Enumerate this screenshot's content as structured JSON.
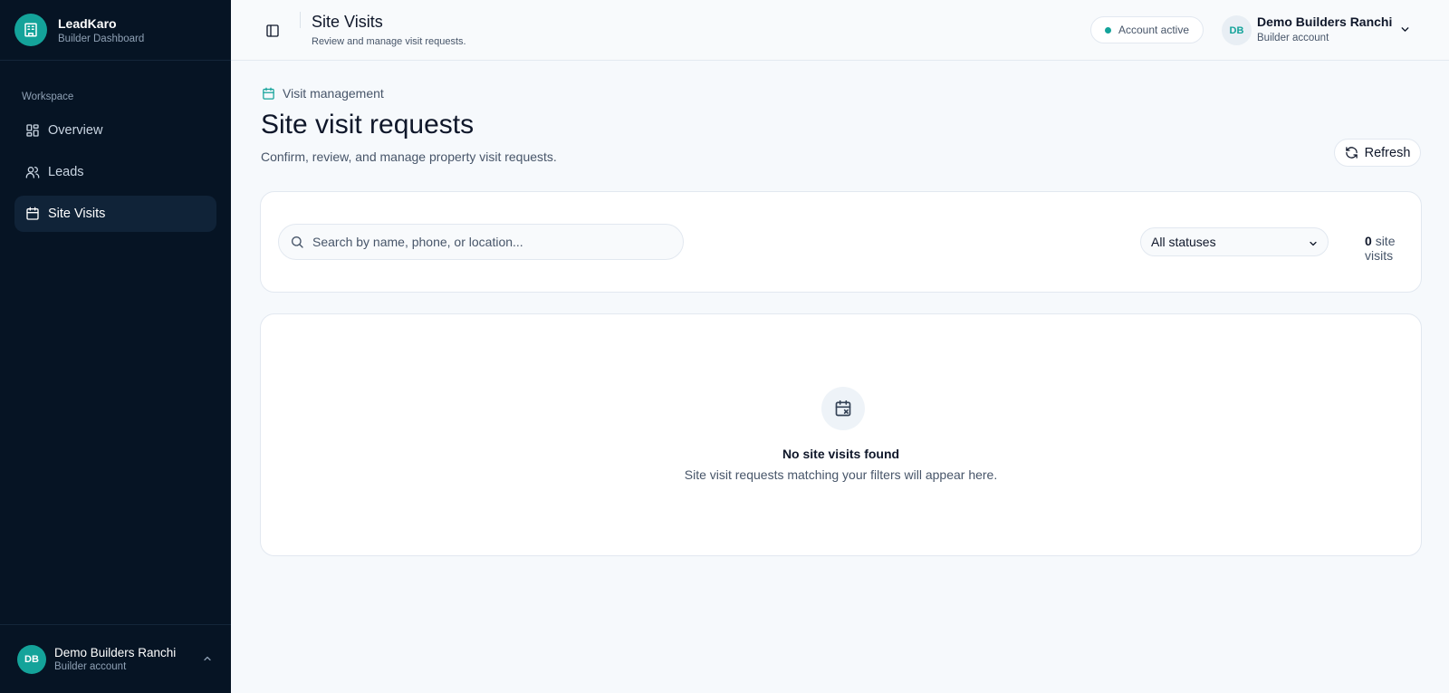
{
  "brand": {
    "name": "LeadKaro",
    "subtitle": "Builder Dashboard"
  },
  "sidebar": {
    "section_label": "Workspace",
    "items": [
      {
        "label": "Overview",
        "icon": "grid-icon",
        "active": false
      },
      {
        "label": "Leads",
        "icon": "users-icon",
        "active": false
      },
      {
        "label": "Site Visits",
        "icon": "calendar-icon",
        "active": true
      }
    ],
    "user": {
      "initials": "DB",
      "name": "Demo Builders Ranchi",
      "role": "Builder account"
    }
  },
  "header": {
    "title": "Site Visits",
    "subtitle": "Review and manage visit requests.",
    "status": "Account active",
    "user": {
      "initials": "DB",
      "name": "Demo Builders Ranchi",
      "role": "Builder account"
    }
  },
  "main": {
    "breadcrumb": "Visit management",
    "title": "Site visit requests",
    "description": "Confirm, review, and manage property visit requests.",
    "refresh_label": "Refresh",
    "search_placeholder": "Search by name, phone, or location...",
    "status_filter": "All statuses",
    "count": "0",
    "count_label": "site visits",
    "empty_title": "No site visits found",
    "empty_description": "Site visit requests matching your filters will appear here."
  },
  "colors": {
    "accent": "#14a39a",
    "sidebar_bg": "#061424",
    "page_bg": "#f6f9fc"
  }
}
